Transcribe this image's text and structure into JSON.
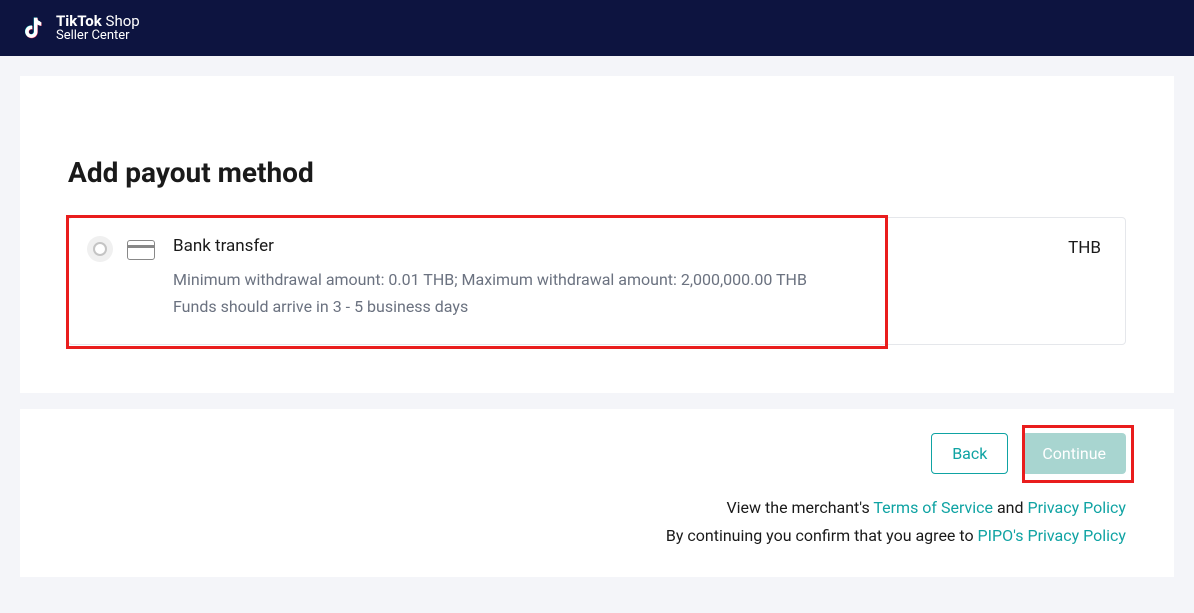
{
  "header": {
    "brand_bold": "TikTok",
    "brand_light": "Shop",
    "subtitle": "Seller Center"
  },
  "page": {
    "title": "Add payout method"
  },
  "option": {
    "title": "Bank transfer",
    "detail_line1": "Minimum withdrawal amount: 0.01 THB; Maximum withdrawal amount: 2,000,000.00 THB",
    "detail_line2": "Funds should arrive in 3 - 5 business days",
    "currency": "THB"
  },
  "footer": {
    "back_label": "Back",
    "continue_label": "Continue",
    "legal_prefix": "View the merchant's ",
    "tos_label": "Terms of Service",
    "and_text": " and ",
    "privacy_label": "Privacy Policy",
    "confirm_prefix": "By continuing you confirm that you agree to ",
    "pipo_label": "PIPO's Privacy Policy"
  }
}
